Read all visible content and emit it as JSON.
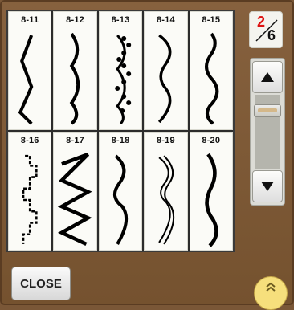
{
  "stitch_tiles": [
    {
      "label": "8-11",
      "icon": "zigzag-stitch-icon"
    },
    {
      "label": "8-12",
      "icon": "crescent-stitch-icon"
    },
    {
      "label": "8-13",
      "icon": "scalloped-stitch-icon"
    },
    {
      "label": "8-14",
      "icon": "scallop-stitch-icon"
    },
    {
      "label": "8-15",
      "icon": "wave-stitch-icon"
    },
    {
      "label": "8-16",
      "icon": "step-stitch-icon"
    },
    {
      "label": "8-17",
      "icon": "wide-zigzag-stitch-icon"
    },
    {
      "label": "8-18",
      "icon": "arc-stitch-icon"
    },
    {
      "label": "8-19",
      "icon": "double-scallop-stitch-icon"
    },
    {
      "label": "8-20",
      "icon": "serpentine-stitch-icon"
    }
  ],
  "page_indicator": {
    "current": "2",
    "total": "6"
  },
  "buttons": {
    "close_label": "CLOSE"
  },
  "colors": {
    "accent_current_page": "#dd1111",
    "expand_button": "#f6df7c",
    "panel_background": "#7a5737"
  }
}
